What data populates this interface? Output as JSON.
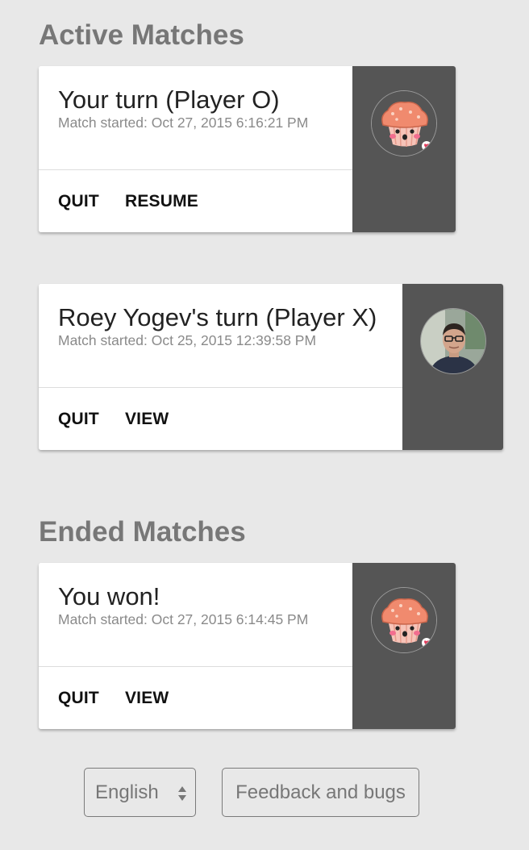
{
  "active_section": {
    "heading": "Active Matches",
    "matches": [
      {
        "title": "Your turn (Player O)",
        "started": "Match started: Oct 27, 2015 6:16:21 PM",
        "actions": [
          "QUIT",
          "RESUME"
        ],
        "avatar_icon": "muffin-avatar-icon"
      },
      {
        "title": "Roey Yogev's turn (Player X)",
        "started": "Match started: Oct 25, 2015 12:39:58 PM",
        "actions": [
          "QUIT",
          "VIEW"
        ],
        "avatar_icon": "player-photo-avatar"
      }
    ]
  },
  "ended_section": {
    "heading": "Ended Matches",
    "matches": [
      {
        "title": "You won!",
        "started": "Match started: Oct 27, 2015 6:14:45 PM",
        "actions": [
          "QUIT",
          "VIEW"
        ],
        "avatar_icon": "muffin-avatar-icon"
      }
    ]
  },
  "footer": {
    "language_selected": "English",
    "feedback_label": "Feedback and bugs"
  },
  "colors": {
    "page_background": "#e8e8e8",
    "side_panel": "#555555",
    "heading_text": "#777777"
  }
}
